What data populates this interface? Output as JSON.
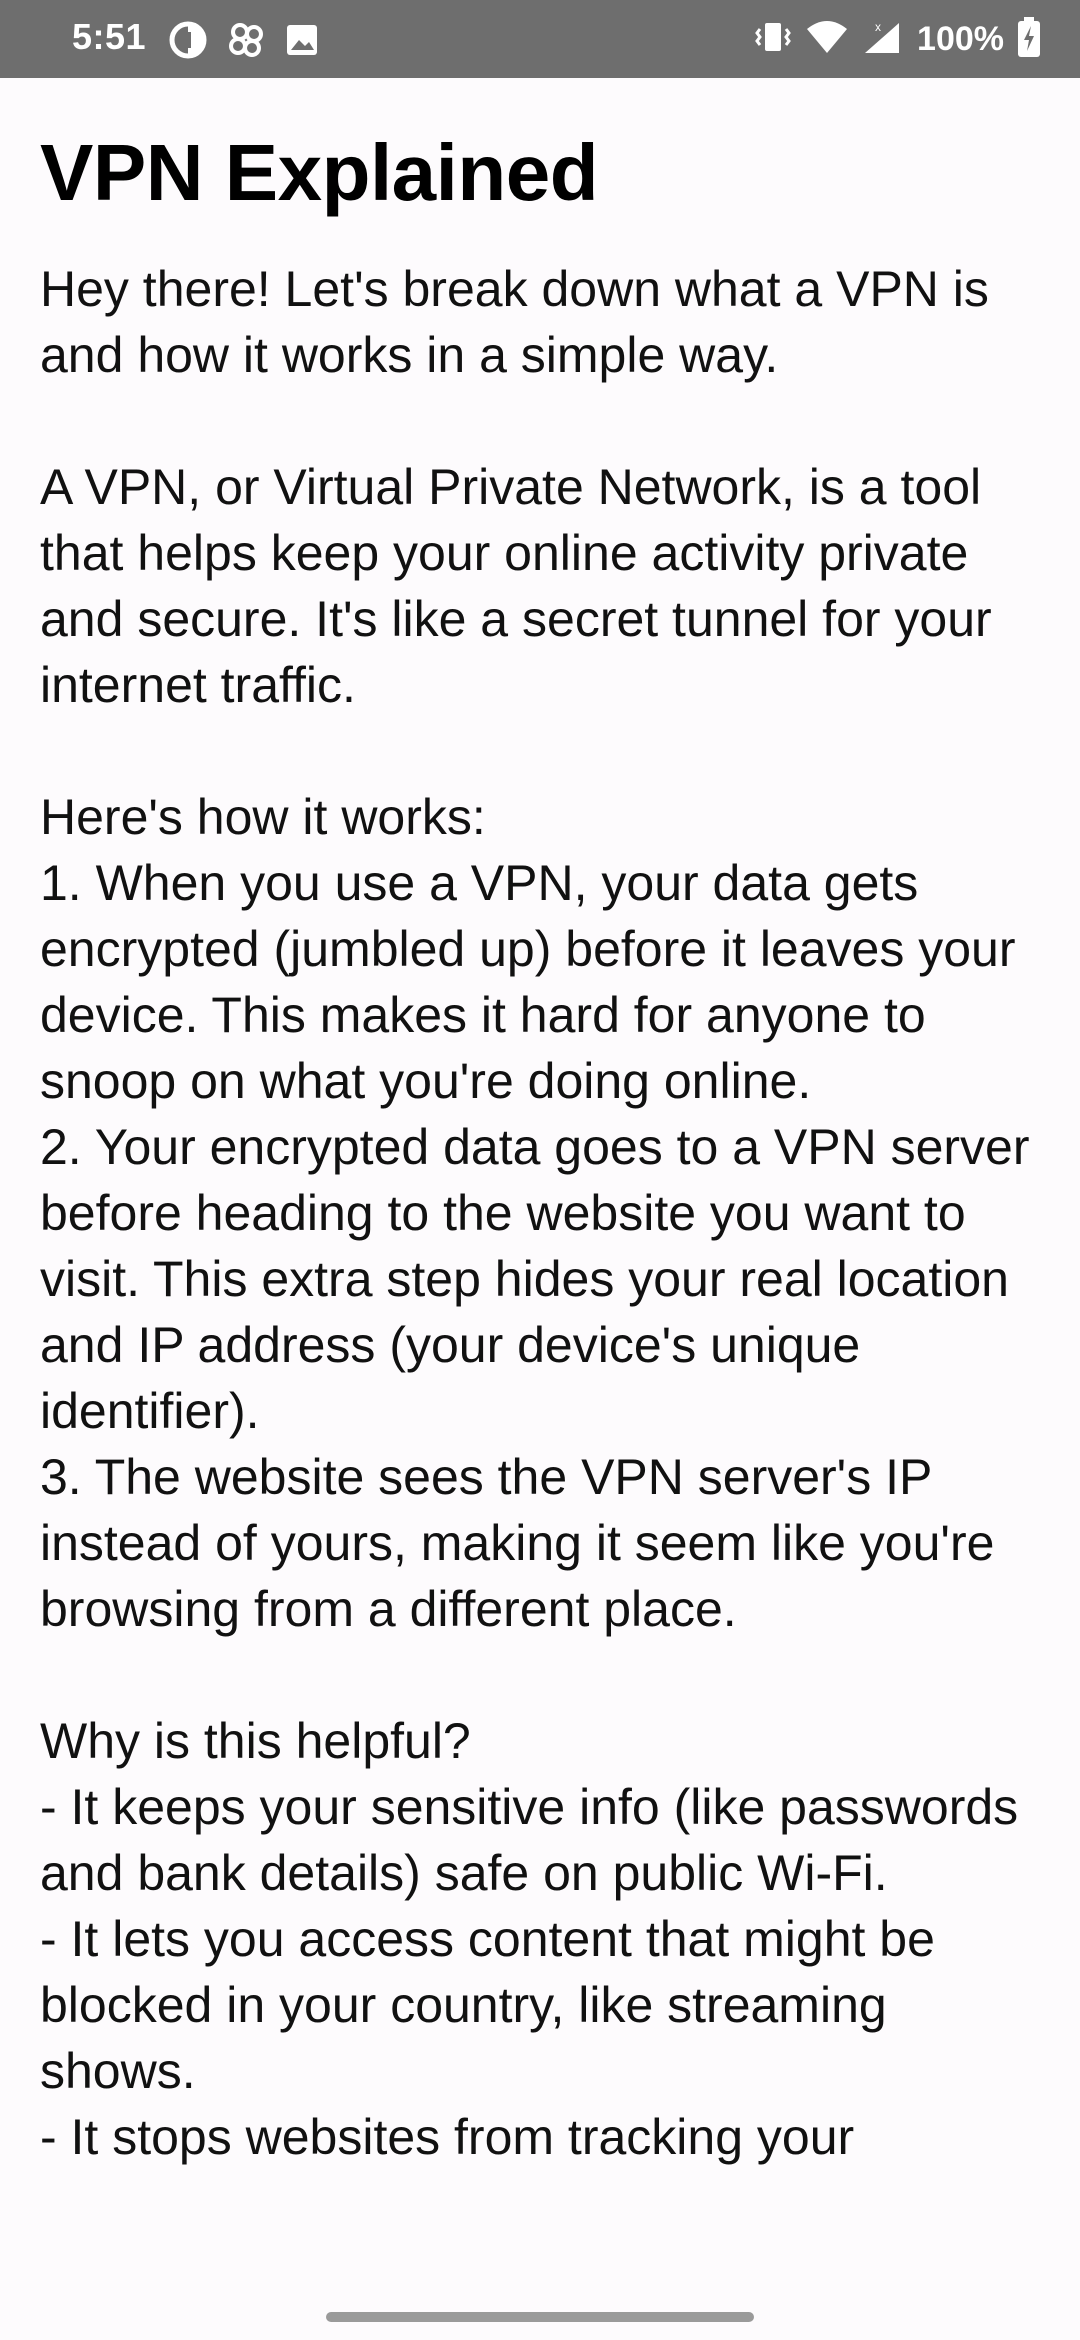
{
  "status_bar": {
    "time": "5:51",
    "left_icons": [
      "data-saver-icon",
      "pinwheel-app-icon",
      "image-icon"
    ],
    "right_icons": [
      "vibrate-icon",
      "wifi-icon",
      "cell-signal-icon",
      "battery-charging-icon"
    ],
    "battery_percent": "100%"
  },
  "article": {
    "title": "VPN Explained",
    "body": "Hey there! Let's break down what a VPN is and how it works in a simple way.\n\nA VPN, or Virtual Private Network, is a tool that helps keep your online activity private and secure. It's like a secret tunnel for your internet traffic.\n\nHere's how it works:\n1. When you use a VPN, your data gets encrypted (jumbled up) before it leaves your device. This makes it hard for anyone to snoop on what you're doing online.\n2. Your encrypted data goes to a VPN server before heading to the website you want to visit. This extra step hides your real location and IP address (your device's unique identifier).\n3. The website sees the VPN server's IP instead of yours, making it seem like you're browsing from a different place.\n\nWhy is this helpful?\n- It keeps your sensitive info (like passwords and bank details) safe on public Wi-Fi.\n- It lets you access content that might be blocked in your country, like streaming shows.\n- It stops websites from tracking your"
  },
  "colors": {
    "status_bar_bg": "#6e6e6e",
    "page_bg": "#fdfbfd",
    "text": "#111111"
  }
}
